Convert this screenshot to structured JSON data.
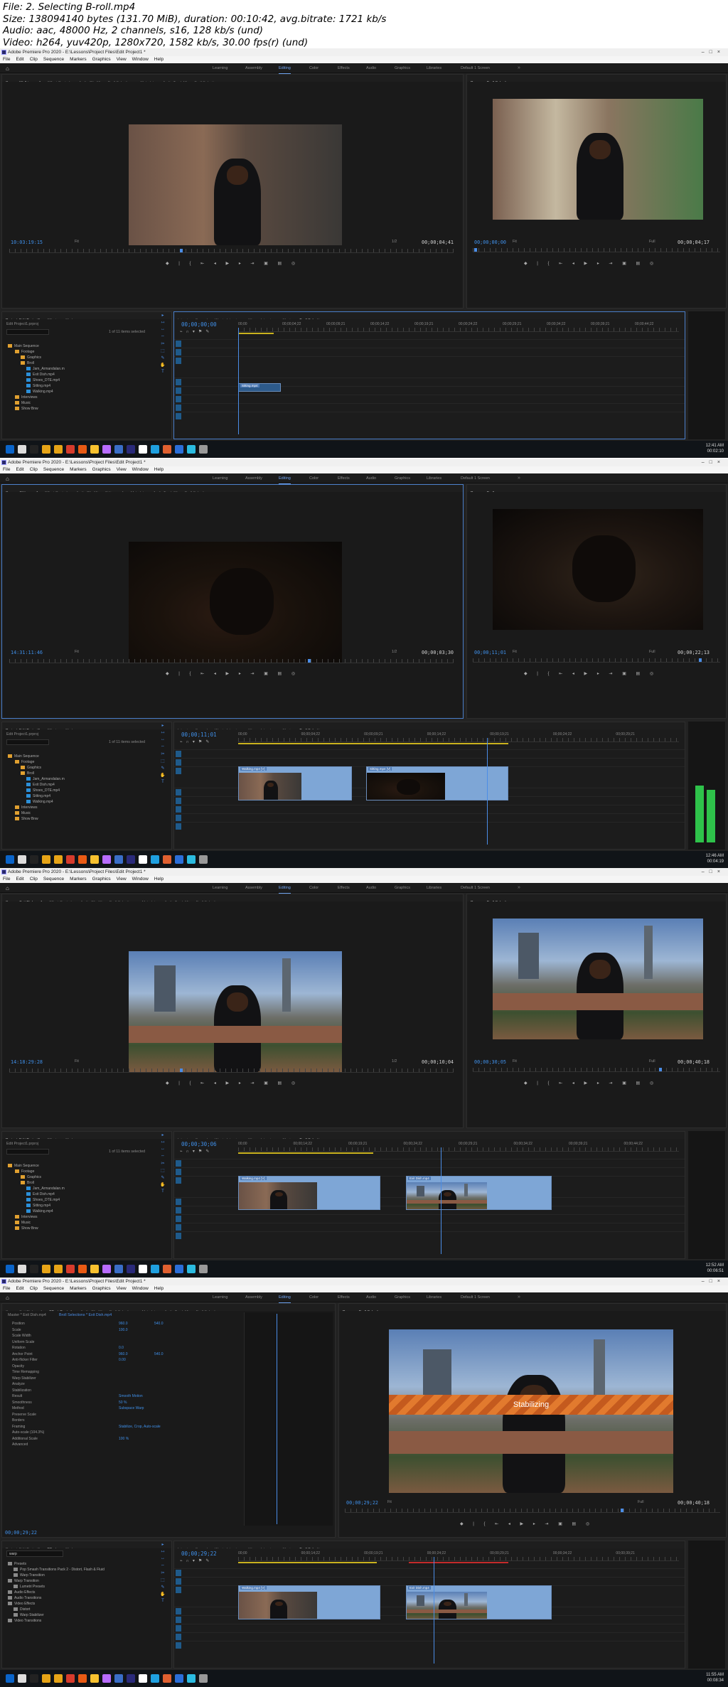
{
  "header": {
    "file": "File: 2. Selecting B-roll.mp4",
    "size": "Size: 138094140 bytes (131.70 MiB), duration: 00:10:42, avg.bitrate: 1721 kb/s",
    "audio": "Audio: aac, 48000 Hz, 2 channels, s16, 128 kb/s (und)",
    "video": "Video: h264, yuv420p, 1280x720, 1582 kb/s, 30.00 fps(r) (und)"
  },
  "app": {
    "title": "Adobe Premiere Pro 2020 - E:\\Lessons\\Project Files\\Edit Project1 *",
    "menu": [
      "File",
      "Edit",
      "Clip",
      "Sequence",
      "Markers",
      "Graphics",
      "View",
      "Window",
      "Help"
    ],
    "workspaces": [
      "Learning",
      "Assembly",
      "Editing",
      "Color",
      "Effects",
      "Audio",
      "Graphics",
      "Libraries",
      "Default 1 Screen"
    ],
    "active_workspace": "Editing"
  },
  "bins": [
    "Main Sequence",
    "Footage",
    "Graphics",
    "Broll",
    "Jam_Armandalan.m",
    "Exit Dish.mp4",
    "Shoes_DTE.mp4",
    "Sitting.mp4",
    "Walking.mp4",
    "Interviews",
    "Music",
    "Show Bnw"
  ],
  "frames": [
    {
      "source_tabs": [
        "Source: Walking.mp4",
        "Effect Controls",
        "Audio Clip Mixer: Broll Selections",
        "Metadata",
        "Audio Track Mixer: Broll Selections"
      ],
      "program_tab": "Program: Broll Selections",
      "source_tc": "10:03:19:15",
      "source_dur": "00;00;04;41",
      "program_tc": "00;00;00;00",
      "program_dur": "00;00;04;17",
      "fit": "Fit",
      "full": "Full",
      "ratio": "1/2",
      "seq_tc": "00;00;00;00",
      "timeline_tabs": [
        "Interviews Synced",
        "Warrie Interview",
        "Wayne Interview",
        "Macie",
        "Broll Selections"
      ],
      "project_tabs": [
        "Project: Edit Project1",
        "Effects",
        "Markers"
      ],
      "project_path": "Edit Project1.prproj",
      "items_count": "1 of 11 items selected",
      "ruler": [
        "00;00",
        "00;00;04;22",
        "00;00;09;21",
        "00;00;14;22",
        "00;00;19;21",
        "00;00;24;22",
        "00;00;29;21",
        "00;00;34;22",
        "00;00;39;21",
        "00;00;44;22"
      ],
      "clips": [
        "Sitting.mp4"
      ],
      "clock": [
        "12:41 AM",
        "00:02:10"
      ]
    },
    {
      "source_tabs": [
        "Source: Sitting.mp4",
        "Effect Controls",
        "Audio Clip Mixer: Sitting.mp4",
        "Metadata",
        "Audio Track Mixer: Broll Selections"
      ],
      "program_tab": "Program: Broll",
      "source_tc": "14:31:11:46",
      "source_dur": "00;00;03;30",
      "program_tc": "00;00;11;01",
      "program_dur": "00;00;22;13",
      "fit": "Fit",
      "full": "Full",
      "ratio": "1/2",
      "seq_tc": "00;00;11;01",
      "timeline_tabs": [
        "Interviews Synced",
        "Warrie Interview",
        "Wayne Interview",
        "Macie",
        "Broll Selections"
      ],
      "project_tabs": [
        "Project: Edit Project1",
        "Effects",
        "Markers"
      ],
      "project_path": "Edit Project1.prproj",
      "items_count": "1 of 11 items selected",
      "ruler": [
        "00;00",
        "00;00;04;22",
        "00;00;09;21",
        "00;00;14;22",
        "00;00;19;21",
        "00;00;24;22",
        "00;00;29;21"
      ],
      "clips": [
        "Walking.mp4 [V]",
        "Sitting.mp4 [V]",
        "Sitting.mp4"
      ],
      "clock": [
        "12:46 AM",
        "00:04:19"
      ]
    },
    {
      "source_tabs": [
        "Source: Exit Dish.mp4",
        "Effect Controls",
        "Audio Clip Mixer: Broll Selections",
        "Metadata",
        "Audio Track Mixer: Broll Selections"
      ],
      "program_tab": "Program: Broll Selections",
      "source_tc": "14:18:29:28",
      "source_dur": "00;00;10;04",
      "program_tc": "00;00;30;05",
      "program_dur": "00;00;40;18",
      "fit": "Fit",
      "full": "Full",
      "ratio": "1/2",
      "seq_tc": "00;00;30;06",
      "timeline_tabs": [
        "Interviews Synced",
        "Warrie Interview",
        "Wayne Interview",
        "Macie",
        "Broll Selections"
      ],
      "project_tabs": [
        "Project: Edit Project1",
        "Effects",
        "Markers"
      ],
      "project_path": "Edit Project1.prproj",
      "items_count": "1 of 11 items selected",
      "ruler": [
        "00;00",
        "00;00;14;22",
        "00;00;19;21",
        "00;00;24;22",
        "00;00;29;21",
        "00;00;34;22",
        "00;00;39;21",
        "00;00;44;22"
      ],
      "clips": [
        "Walking.mp4 [V]",
        "Sitting.mp4 [V]",
        "Sitting.mp4 [V]",
        "Exit Dish.mp4",
        "Exit Dish.mp4"
      ],
      "clock": [
        "12:52 AM",
        "00:06:51"
      ]
    },
    {
      "source_tabs": [
        "Source: Exit Dish.mp4",
        "Effect Controls",
        "Audio Clip Mixer: Broll Selections",
        "Metadata",
        "Audio Track Mixer: Broll Selections"
      ],
      "program_tab": "Program: Broll Selections",
      "source_tc": "00;00;29;22",
      "source_dur": "",
      "program_tc": "00;00;29;22",
      "program_dur": "00;00;40;18",
      "fit": "Fit",
      "full": "Full",
      "ratio": "1/2",
      "seq_tc": "00;00;29;22",
      "timeline_tabs": [
        "Interviews Synced",
        "Warrie Interview",
        "Wayne Interview",
        "Macie",
        "Broll Selections"
      ],
      "project_tabs": [
        "Project: Edit Project1",
        "Effects",
        "Markers"
      ],
      "project_path": "Edit Project1.prproj",
      "items_count": "",
      "ruler": [
        "00;00",
        "00;00;14;22",
        "00;00;19;21",
        "00;00;24;22",
        "00;00;29;21",
        "00;00;34;22",
        "00;00;39;21"
      ],
      "clips": [
        "Walking.mp4 [V]",
        "Sitting.mp4 [V]",
        "Sitting.mp4 [V]",
        "Exit Dish.mp4",
        "Exit Dish.mp4"
      ],
      "clock": [
        "11:55 AM",
        "00:08:34"
      ],
      "effect_controls": {
        "clip": "Master * Exit Dish.mp4",
        "seq": "Broll Selections * Exit Dish.mp4",
        "props": [
          [
            "Position",
            "960.0",
            "540.0"
          ],
          [
            "Scale",
            "100.0",
            ""
          ],
          [
            "Scale Width",
            "",
            ""
          ],
          [
            "Uniform Scale",
            "",
            ""
          ],
          [
            "Rotation",
            "0.0",
            ""
          ],
          [
            "Anchor Point",
            "960.0",
            "540.0"
          ],
          [
            "Anti-flicker Filter",
            "0.00",
            ""
          ],
          [
            "Opacity",
            "",
            ""
          ],
          [
            "Time Remapping",
            "",
            ""
          ],
          [
            "Warp Stabilizer",
            "",
            ""
          ],
          [
            "Analyze",
            "",
            ""
          ],
          [
            "Stabilization",
            "",
            ""
          ],
          [
            "Result",
            "Smooth Motion",
            ""
          ],
          [
            "Smoothness",
            "50 %",
            ""
          ],
          [
            "Method",
            "Subspace Warp",
            ""
          ],
          [
            "Preserve Scale",
            "",
            ""
          ],
          [
            "Borders",
            "",
            ""
          ],
          [
            "Framing",
            "Stabilize, Crop, Auto-scale",
            ""
          ],
          [
            "Auto-scale (104.3%)",
            "",
            ""
          ],
          [
            "Additional Scale",
            "100 %",
            ""
          ],
          [
            "Advanced",
            "",
            ""
          ]
        ],
        "effects_search": "warp",
        "effects_tree": [
          "Presets",
          "Pop Smash Transitions Pack 2 - Distort, Flash & Fluid",
          "Warp Transition",
          "Warp Transition",
          "Lumetri Presets",
          "Audio Effects",
          "Audio Transitions",
          "Video Effects",
          "Distort",
          "Warp Stabilizer",
          "Video Transitions"
        ],
        "stabilizing": "Stabilizing"
      }
    }
  ],
  "colors": {
    "accent": "#4b8de6",
    "timecode": "#3f8fe8",
    "panel_bg": "#1a1a1a",
    "yellow_work": "#c9b21e",
    "red_render": "#c42b2b",
    "stabilizing": "#e27a2e"
  }
}
